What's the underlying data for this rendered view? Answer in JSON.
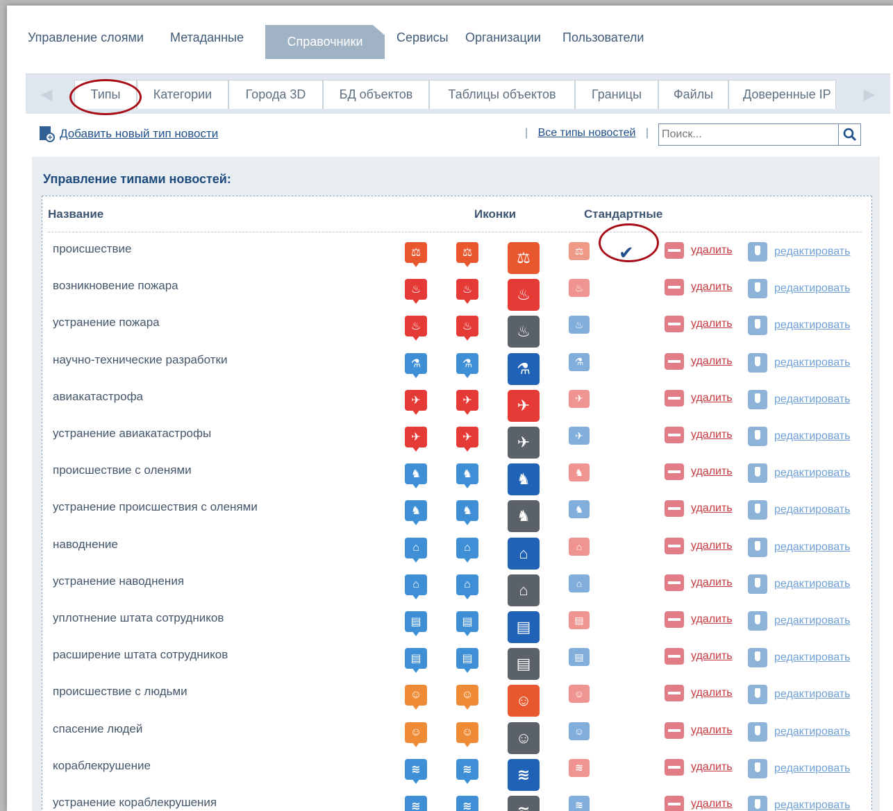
{
  "topnav": {
    "items": [
      "Управление слоями",
      "Метаданные",
      "Справочники",
      "Сервисы",
      "Организации",
      "Пользователи"
    ],
    "active": "Справочники"
  },
  "tabs": [
    "Типы",
    "Категории",
    "Города 3D",
    "БД объектов",
    "Таблицы объектов",
    "Границы",
    "Файлы",
    "Доверенные IP"
  ],
  "toolbar": {
    "add_label": "Добавить новый тип новости",
    "all_types_label": "Все типы новостей",
    "separator": "|",
    "search_placeholder": "Поиск..."
  },
  "panel": {
    "title": "Управление типами новостей:",
    "columns": {
      "name": "Название",
      "icons": "Иконки",
      "standard": "Стандартные"
    },
    "delete_label": "удалить",
    "edit_label": "редактировать",
    "standard_mark": "✔"
  },
  "rows": [
    {
      "name": "происшествие",
      "color": "#e8572e",
      "big": "#e8572e",
      "std": "#ef9a86",
      "glyph": "⚖",
      "standard": true
    },
    {
      "name": "возникновение пожара",
      "color": "#e63a37",
      "big": "#e63a37",
      "std": "#ef9491",
      "glyph": "♨",
      "standard": false
    },
    {
      "name": "устранение пожара",
      "color": "#e63a37",
      "big": "#5b6168",
      "std": "#82aedb",
      "glyph": "♨",
      "standard": false
    },
    {
      "name": "научно-технические разработки",
      "color": "#3f8fd6",
      "big": "#1f62b6",
      "std": "#82aedb",
      "glyph": "⚗",
      "standard": false
    },
    {
      "name": "авиакатастрофа",
      "color": "#e63a37",
      "big": "#e63a37",
      "std": "#ef9491",
      "glyph": "✈",
      "standard": false
    },
    {
      "name": "устранение авиакатастрофы",
      "color": "#e63a37",
      "big": "#5b6168",
      "std": "#82aedb",
      "glyph": "✈",
      "standard": false
    },
    {
      "name": "происшествие с оленями",
      "color": "#3f8fd6",
      "big": "#1f62b6",
      "std": "#ef9491",
      "glyph": "♞",
      "standard": false
    },
    {
      "name": "устранение происшествия с оленями",
      "color": "#3f8fd6",
      "big": "#5b6168",
      "std": "#82aedb",
      "glyph": "♞",
      "standard": false
    },
    {
      "name": "наводнение",
      "color": "#3f8fd6",
      "big": "#1f62b6",
      "std": "#ef9491",
      "glyph": "⌂",
      "standard": false
    },
    {
      "name": "устранение наводнения",
      "color": "#3f8fd6",
      "big": "#5b6168",
      "std": "#82aedb",
      "glyph": "⌂",
      "standard": false
    },
    {
      "name": "уплотнение штата сотрудников",
      "color": "#3f8fd6",
      "big": "#1f62b6",
      "std": "#ef9491",
      "glyph": "▤",
      "standard": false
    },
    {
      "name": "расширение штата сотрудников",
      "color": "#3f8fd6",
      "big": "#5b6168",
      "std": "#82aedb",
      "glyph": "▤",
      "standard": false
    },
    {
      "name": "происшествие с людьми",
      "color": "#ef8a36",
      "big": "#e8572e",
      "std": "#ef9491",
      "glyph": "☺",
      "standard": false
    },
    {
      "name": "спасение людей",
      "color": "#ef8a36",
      "big": "#5b6168",
      "std": "#82aedb",
      "glyph": "☺",
      "standard": false
    },
    {
      "name": "кораблекрушение",
      "color": "#3f8fd6",
      "big": "#1f62b6",
      "std": "#ef9491",
      "glyph": "≋",
      "standard": false
    },
    {
      "name": "устранение кораблекрушения",
      "color": "#3f8fd6",
      "big": "#5b6168",
      "std": "#82aedb",
      "glyph": "≋",
      "standard": false
    }
  ]
}
